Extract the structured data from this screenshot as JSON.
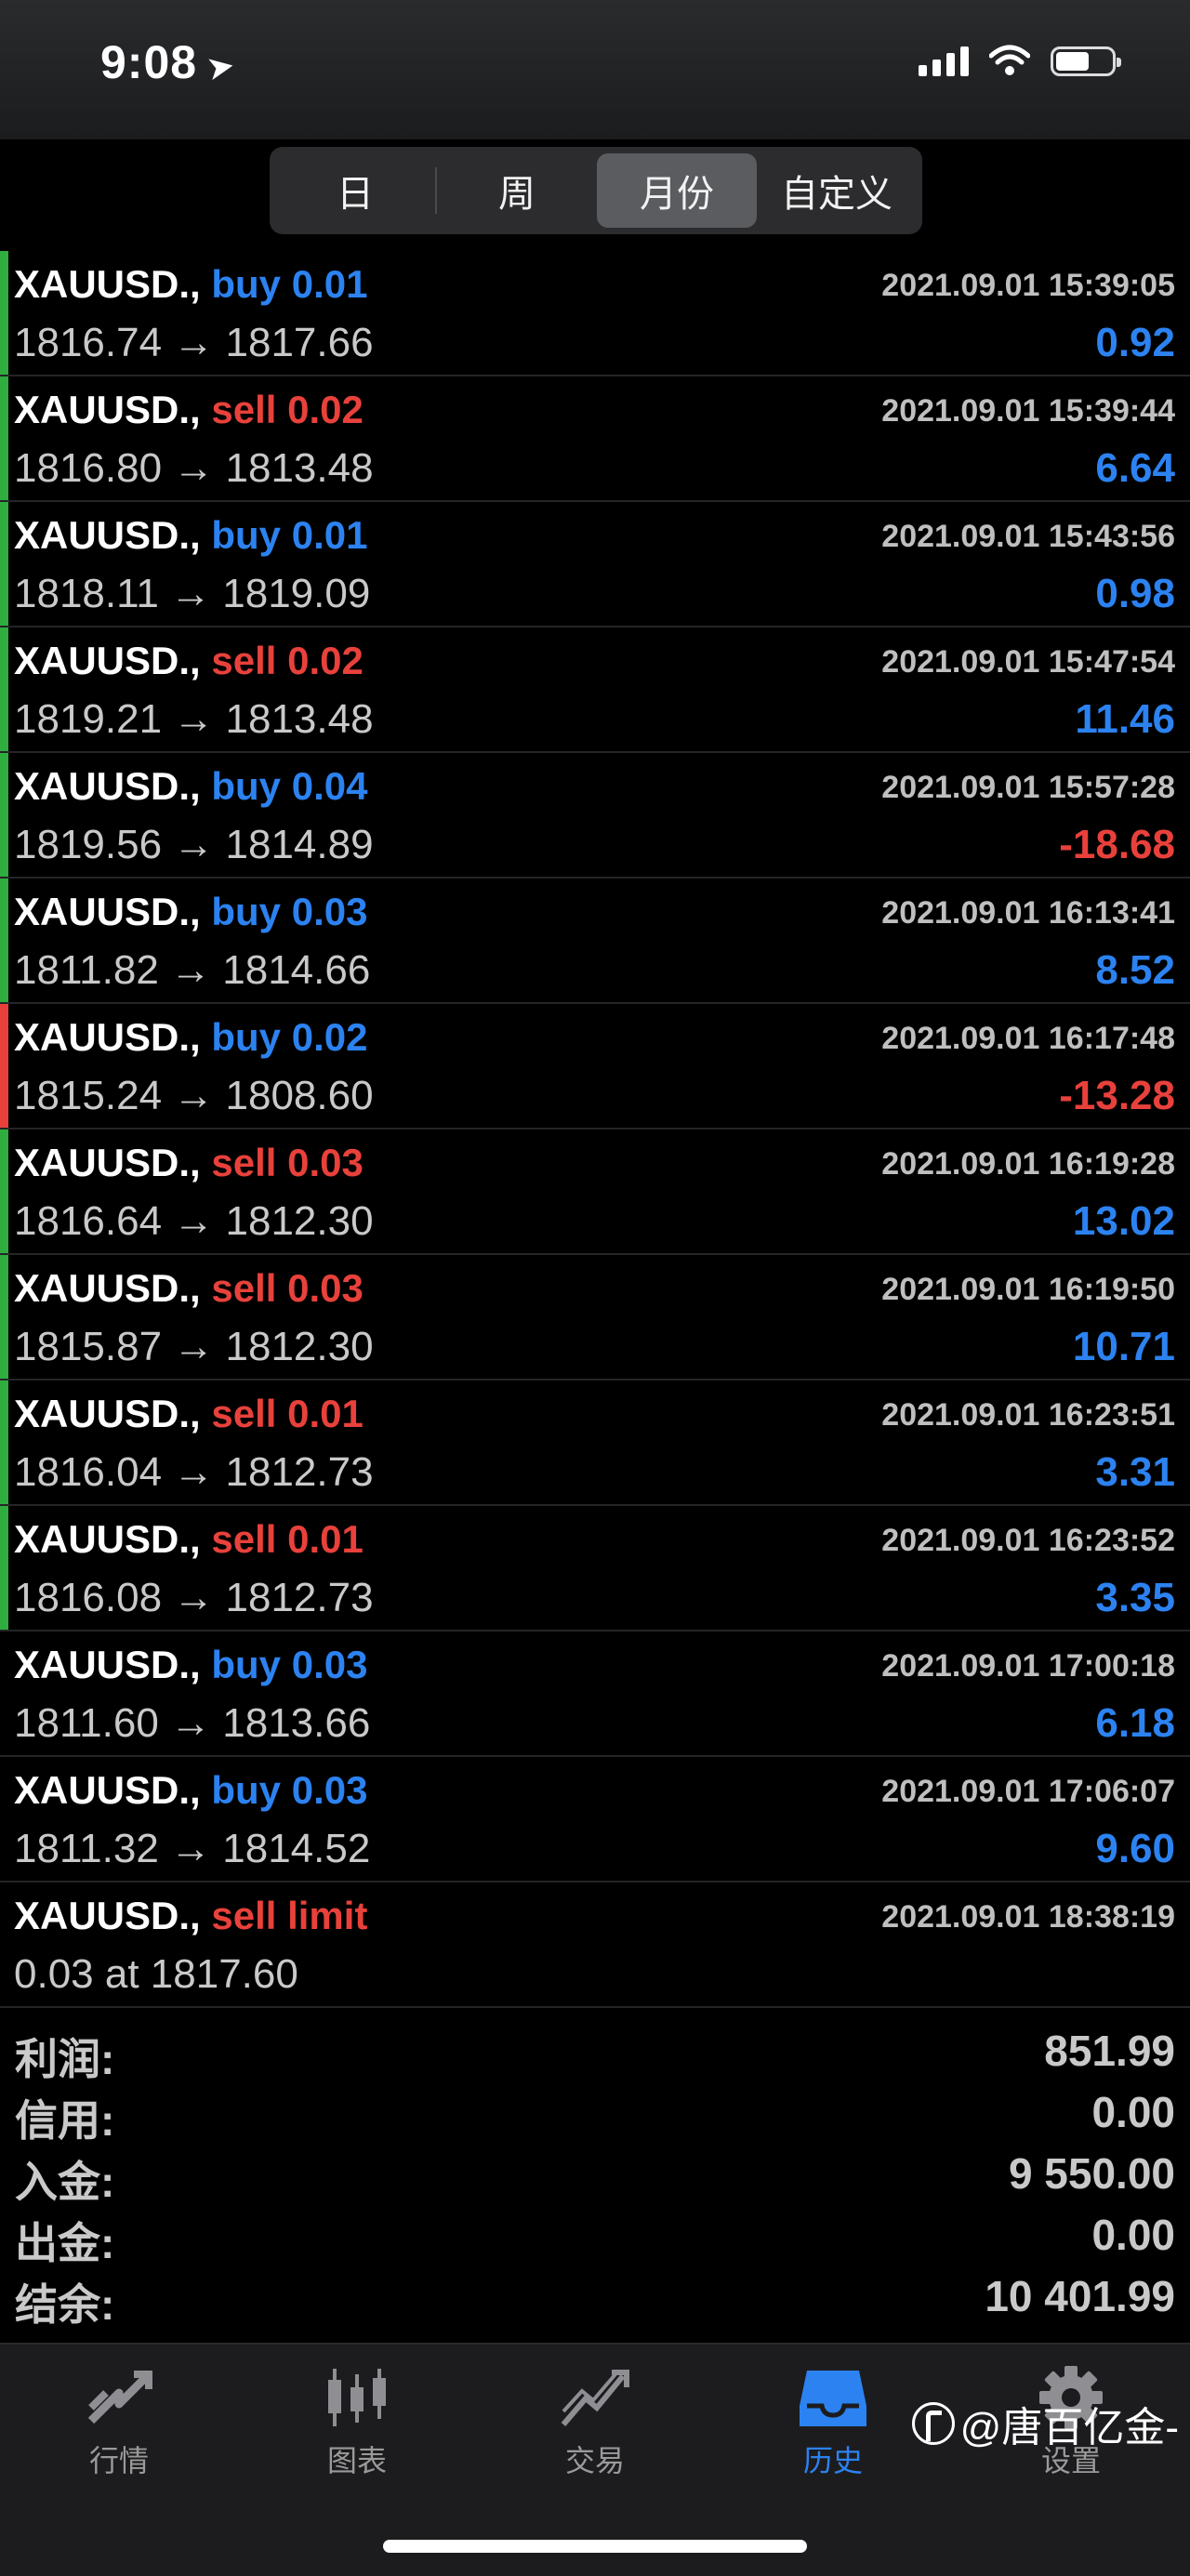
{
  "status": {
    "time": "9:08"
  },
  "segments": [
    {
      "label": "日",
      "active": false
    },
    {
      "label": "周",
      "active": false
    },
    {
      "label": "月份",
      "active": true
    },
    {
      "label": "自定义",
      "active": false
    }
  ],
  "deals": [
    {
      "symbol": "XAUUSD.,",
      "side": "buy",
      "volume": "0.01",
      "time": "2021.09.01 15:39:05",
      "open": "1816.74",
      "close": "1817.66",
      "profit": "0.92",
      "bar": "green"
    },
    {
      "symbol": "XAUUSD.,",
      "side": "sell",
      "volume": "0.02",
      "time": "2021.09.01 15:39:44",
      "open": "1816.80",
      "close": "1813.48",
      "profit": "6.64",
      "bar": "green"
    },
    {
      "symbol": "XAUUSD.,",
      "side": "buy",
      "volume": "0.01",
      "time": "2021.09.01 15:43:56",
      "open": "1818.11",
      "close": "1819.09",
      "profit": "0.98",
      "bar": "green"
    },
    {
      "symbol": "XAUUSD.,",
      "side": "sell",
      "volume": "0.02",
      "time": "2021.09.01 15:47:54",
      "open": "1819.21",
      "close": "1813.48",
      "profit": "11.46",
      "bar": "green"
    },
    {
      "symbol": "XAUUSD.,",
      "side": "buy",
      "volume": "0.04",
      "time": "2021.09.01 15:57:28",
      "open": "1819.56",
      "close": "1814.89",
      "profit": "-18.68",
      "bar": "green"
    },
    {
      "symbol": "XAUUSD.,",
      "side": "buy",
      "volume": "0.03",
      "time": "2021.09.01 16:13:41",
      "open": "1811.82",
      "close": "1814.66",
      "profit": "8.52",
      "bar": "green"
    },
    {
      "symbol": "XAUUSD.,",
      "side": "buy",
      "volume": "0.02",
      "time": "2021.09.01 16:17:48",
      "open": "1815.24",
      "close": "1808.60",
      "profit": "-13.28",
      "bar": "red"
    },
    {
      "symbol": "XAUUSD.,",
      "side": "sell",
      "volume": "0.03",
      "time": "2021.09.01 16:19:28",
      "open": "1816.64",
      "close": "1812.30",
      "profit": "13.02",
      "bar": "green"
    },
    {
      "symbol": "XAUUSD.,",
      "side": "sell",
      "volume": "0.03",
      "time": "2021.09.01 16:19:50",
      "open": "1815.87",
      "close": "1812.30",
      "profit": "10.71",
      "bar": "green"
    },
    {
      "symbol": "XAUUSD.,",
      "side": "sell",
      "volume": "0.01",
      "time": "2021.09.01 16:23:51",
      "open": "1816.04",
      "close": "1812.73",
      "profit": "3.31",
      "bar": "green"
    },
    {
      "symbol": "XAUUSD.,",
      "side": "sell",
      "volume": "0.01",
      "time": "2021.09.01 16:23:52",
      "open": "1816.08",
      "close": "1812.73",
      "profit": "3.35",
      "bar": "green"
    },
    {
      "symbol": "XAUUSD.,",
      "side": "buy",
      "volume": "0.03",
      "time": "2021.09.01 17:00:18",
      "open": "1811.60",
      "close": "1813.66",
      "profit": "6.18",
      "bar": "none"
    },
    {
      "symbol": "XAUUSD.,",
      "side": "buy",
      "volume": "0.03",
      "time": "2021.09.01 17:06:07",
      "open": "1811.32",
      "close": "1814.52",
      "profit": "9.60",
      "bar": "none"
    }
  ],
  "order": {
    "symbol": "XAUUSD.,",
    "type": "sell limit",
    "time": "2021.09.01 18:38:19",
    "detail": "0.03 at 1817.60"
  },
  "summary": [
    {
      "label": "利润:",
      "value": "851.99"
    },
    {
      "label": "信用:",
      "value": "0.00"
    },
    {
      "label": "入金:",
      "value": "9 550.00"
    },
    {
      "label": "出金:",
      "value": "0.00"
    },
    {
      "label": "结余:",
      "value": "10 401.99"
    }
  ],
  "tabs": [
    {
      "label": "行情",
      "icon": "quotes-arrows-icon",
      "active": false
    },
    {
      "label": "图表",
      "icon": "candlestick-chart-icon",
      "active": false
    },
    {
      "label": "交易",
      "icon": "trade-chart-icon",
      "active": false
    },
    {
      "label": "历史",
      "icon": "history-inbox-icon",
      "active": true
    },
    {
      "label": "设置",
      "icon": "gear-icon",
      "active": false
    }
  ],
  "watermark": "@唐百亿金-",
  "colors": {
    "buy": "#2c82f0",
    "sell": "#e8413b",
    "profit_pos": "#2c82f0",
    "profit_neg": "#e8413b",
    "bar_green": "#2fae3f",
    "bar_red": "#e8413b",
    "tab_active": "#2c82f0"
  }
}
